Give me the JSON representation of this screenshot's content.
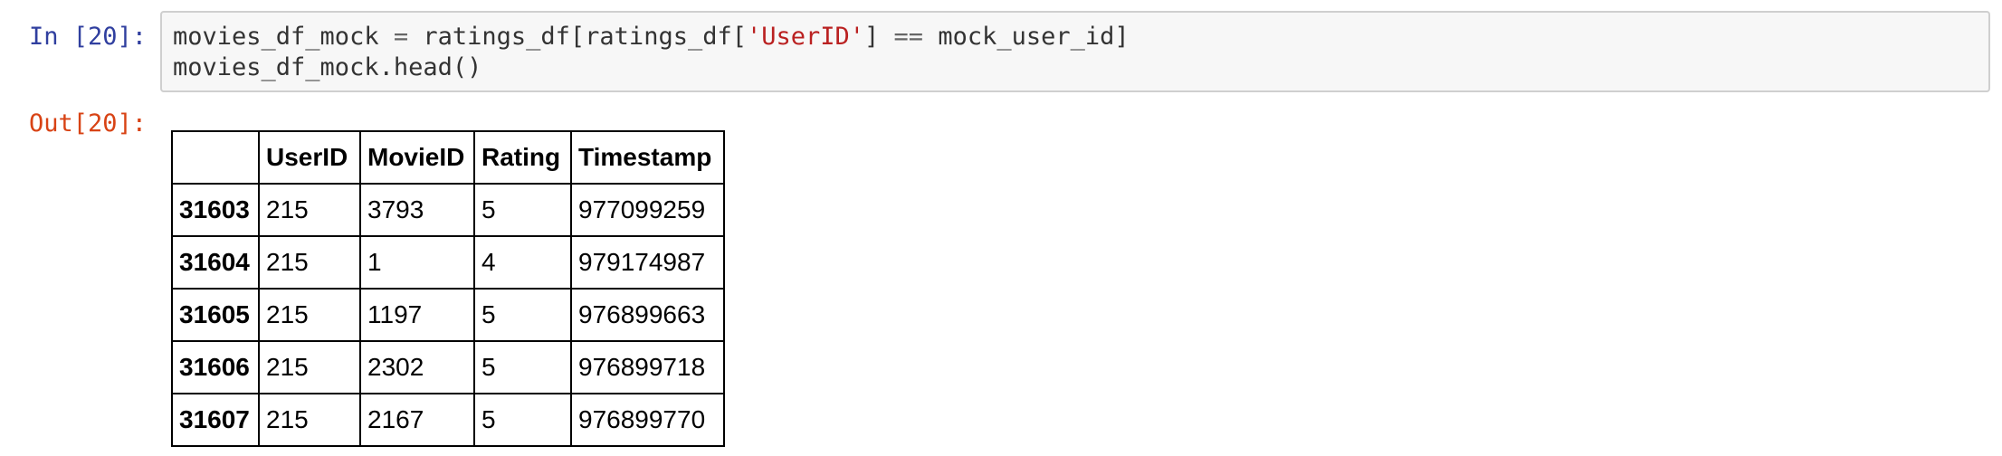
{
  "cell": {
    "in_prompt": "In [20]:",
    "out_prompt": "Out[20]:",
    "code": {
      "line1": {
        "var": "movies_df_mock",
        "eq": " = ",
        "expr_a": "ratings_df[ratings_df[",
        "str": "'UserID'",
        "expr_b": "] ",
        "op": "==",
        "expr_c": " mock_user_id]"
      },
      "line2": "movies_df_mock.head()"
    }
  },
  "table": {
    "corner": "",
    "columns": [
      "UserID",
      "MovieID",
      "Rating",
      "Timestamp"
    ],
    "rows": [
      {
        "index": "31603",
        "values": [
          "215",
          "3793",
          "5",
          "977099259"
        ]
      },
      {
        "index": "31604",
        "values": [
          "215",
          "1",
          "4",
          "979174987"
        ]
      },
      {
        "index": "31605",
        "values": [
          "215",
          "1197",
          "5",
          "976899663"
        ]
      },
      {
        "index": "31606",
        "values": [
          "215",
          "2302",
          "5",
          "976899718"
        ]
      },
      {
        "index": "31607",
        "values": [
          "215",
          "2167",
          "5",
          "976899770"
        ]
      }
    ]
  }
}
